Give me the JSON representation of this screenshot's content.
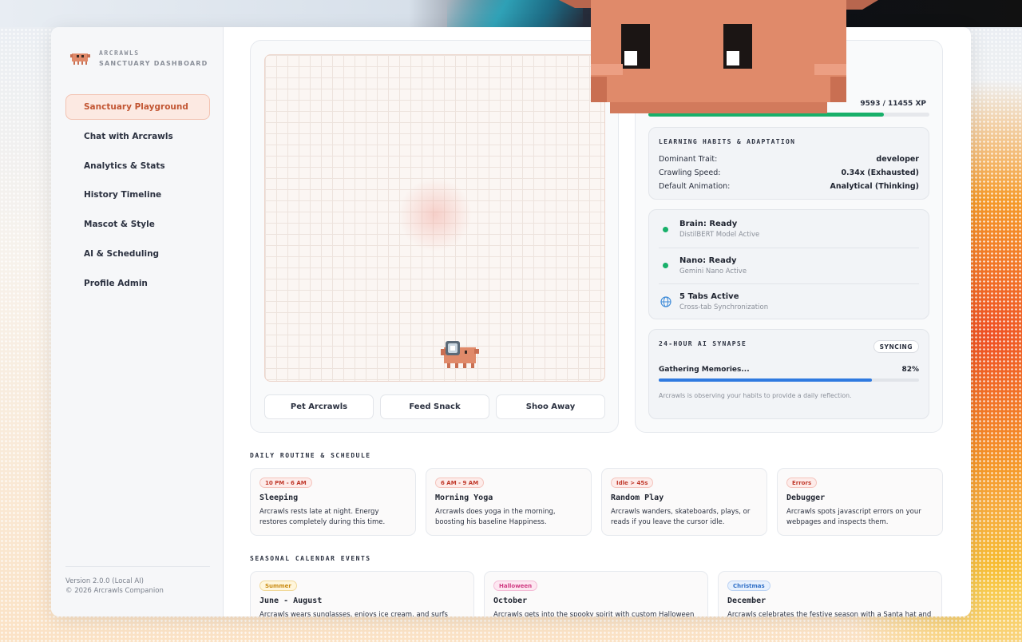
{
  "app": {
    "brand_name": "ARCRAWLS",
    "brand_sub": "SANCTUARY DASHBOARD"
  },
  "sidebar": {
    "items": [
      {
        "label": "Sanctuary Playground"
      },
      {
        "label": "Chat with Arcrawls"
      },
      {
        "label": "Analytics & Stats"
      },
      {
        "label": "History Timeline"
      },
      {
        "label": "Mascot & Style"
      },
      {
        "label": "AI & Scheduling"
      },
      {
        "label": "Profile Admin"
      }
    ],
    "version": "Version 2.0.0 (Local AI)",
    "copyright": "© 2026 Arcrawls Companion"
  },
  "playground": {
    "actions": [
      {
        "label": "Pet Arcrawls"
      },
      {
        "label": "Feed Snack"
      },
      {
        "label": "Shoo Away"
      }
    ]
  },
  "stats": {
    "xp_label": "9593 / 11455 XP",
    "xp_fraction": 0.8375,
    "habits": {
      "title": "LEARNING HABITS & ADAPTATION",
      "rows": [
        {
          "key": "Dominant Trait:",
          "value": "developer"
        },
        {
          "key": "Crawling Speed:",
          "value": "0.34x (Exhausted)"
        },
        {
          "key": "Default Animation:",
          "value": "Analytical (Thinking)"
        }
      ]
    },
    "status": [
      {
        "main": "Brain: Ready",
        "sub": "DistilBERT Model Active",
        "icon": "green-dot"
      },
      {
        "main": "Nano: Ready",
        "sub": "Gemini Nano Active",
        "icon": "green-dot"
      },
      {
        "main": "5 Tabs Active",
        "sub": "Cross-tab Synchronization",
        "icon": "globe-icon"
      }
    ],
    "synapse": {
      "title": "24-HOUR AI SYNAPSE",
      "badge": "SYNCING",
      "progress_label": "Gathering Memories...",
      "progress_value": "82%",
      "progress_fraction": 0.82,
      "note": "Arcrawls is observing your habits to provide a daily reflection."
    }
  },
  "routine": {
    "heading": "DAILY ROUTINE & SCHEDULE",
    "tiles": [
      {
        "badge": "10 PM - 6 AM",
        "title": "Sleeping",
        "desc": "Arcrawls rests late at night. Energy restores completely during this time."
      },
      {
        "badge": "6 AM - 9 AM",
        "title": "Morning Yoga",
        "desc": "Arcrawls does yoga in the morning, boosting his baseline Happiness."
      },
      {
        "badge": "Idle > 45s",
        "title": "Random Play",
        "desc": "Arcrawls wanders, skateboards, plays, or reads if you leave the cursor idle."
      },
      {
        "badge": "Errors",
        "title": "Debugger",
        "desc": "Arcrawls spots javascript errors on your webpages and inspects them."
      }
    ]
  },
  "seasonal": {
    "heading": "SEASONAL CALENDAR EVENTS",
    "tiles": [
      {
        "badge": "Summer",
        "title": "June - August",
        "desc": "Arcrawls wears sunglasses, enjoys ice cream, and surfs around"
      },
      {
        "badge": "Halloween",
        "title": "October",
        "desc": "Arcrawls gets into the spooky spirit with custom Halloween"
      },
      {
        "badge": "Christmas",
        "title": "December",
        "desc": "Arcrawls celebrates the festive season with a Santa hat and"
      }
    ]
  },
  "colors": {
    "accent": "#c25633",
    "xp_green": "#18b06a",
    "progress_blue": "#2f7ae0",
    "mascot": "#e08a6a"
  }
}
